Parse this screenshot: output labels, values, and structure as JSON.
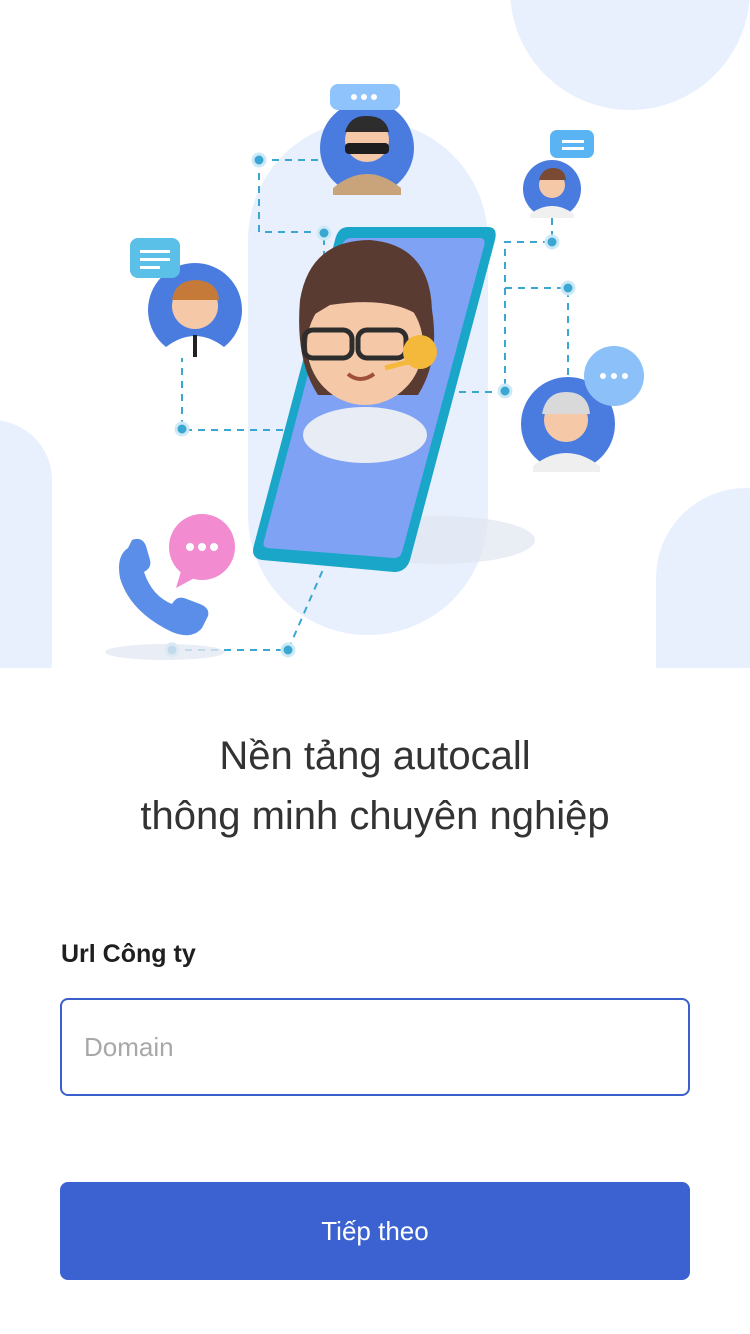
{
  "hero": {
    "icons": [
      "phone-with-agent-icon",
      "headset-icon",
      "avatar-icon",
      "chat-bubble-icon",
      "phone-call-icon"
    ]
  },
  "tagline": {
    "line1": "Nền tảng autocall",
    "line2": "thông minh chuyên nghiệp"
  },
  "form": {
    "label": "Url Công ty",
    "domain_placeholder": "Domain",
    "domain_value": ""
  },
  "actions": {
    "next_label": "Tiếp theo"
  },
  "colors": {
    "primary": "#3b62d0",
    "input_border": "#3b60cd",
    "bg_shape": "#e9f0fd",
    "avatar_blue": "#4a7ce0",
    "phone_teal": "#1aa6c8",
    "connector": "#3aa7d2"
  }
}
